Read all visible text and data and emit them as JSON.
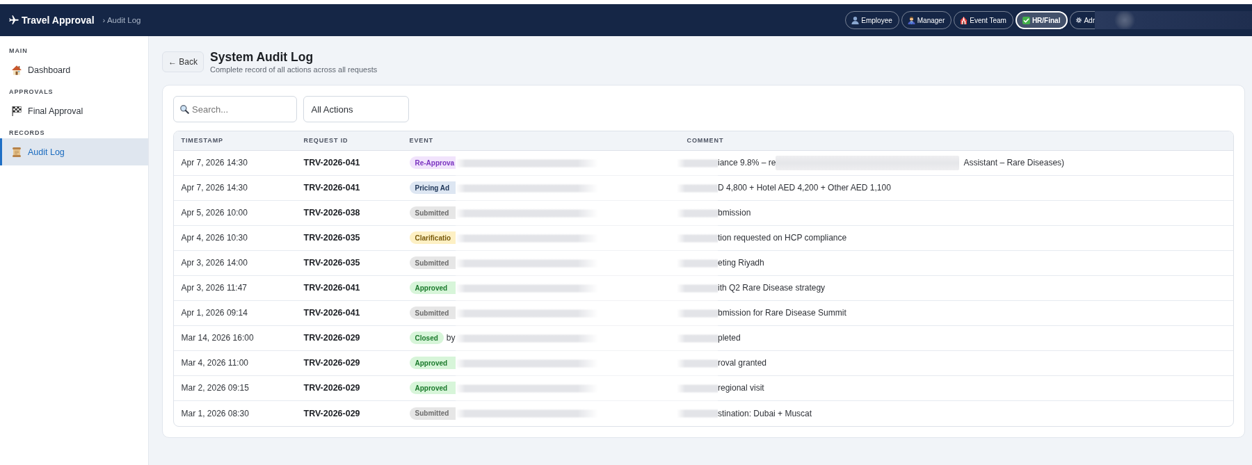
{
  "app": {
    "title": "Travel Approval",
    "breadcrumb": "› Audit Log"
  },
  "roles": [
    {
      "label": "Employee",
      "selected": false
    },
    {
      "label": "Manager",
      "selected": false
    },
    {
      "label": "Event Team",
      "selected": false
    },
    {
      "label": "HR/Final",
      "selected": true
    },
    {
      "label": "Adr",
      "selected": false
    }
  ],
  "sidebar": {
    "sections": [
      {
        "label": "MAIN",
        "items": [
          {
            "label": "Dashboard",
            "selected": false
          }
        ]
      },
      {
        "label": "APPROVALS",
        "items": [
          {
            "label": "Final Approval",
            "selected": false
          }
        ]
      },
      {
        "label": "RECORDS",
        "items": [
          {
            "label": "Audit Log",
            "selected": true
          }
        ]
      }
    ]
  },
  "page": {
    "back_button": "← Back",
    "title": "System Audit Log",
    "subtitle": "Complete record of all actions across all requests"
  },
  "filters": {
    "search": {
      "placeholder": "Search..."
    },
    "action_filter": {
      "value": "All Actions"
    }
  },
  "table": {
    "columns": [
      "TIMESTAMP",
      "REQUEST ID",
      "EVENT",
      "COMMENT"
    ],
    "rows": [
      {
        "timestamp": "Apr 7, 2026 14:30",
        "request_id": "TRV-2026-041",
        "event": {
          "kind": "reapproval",
          "badge": "Re-Approva"
        },
        "comment_fragments": [
          "iance 9.8% – re",
          "Assistant – Rare Diseases)"
        ]
      },
      {
        "timestamp": "Apr 7, 2026 14:30",
        "request_id": "TRV-2026-041",
        "event": {
          "kind": "pricing",
          "badge": "Pricing Ad"
        },
        "comment_fragments": [
          "D 4,800 + Hotel AED 4,200 + Other AED 1,100"
        ]
      },
      {
        "timestamp": "Apr 5, 2026 10:00",
        "request_id": "TRV-2026-038",
        "event": {
          "kind": "submitted",
          "badge": "Submitted"
        },
        "comment_fragments": [
          "bmission"
        ]
      },
      {
        "timestamp": "Apr 4, 2026 10:30",
        "request_id": "TRV-2026-035",
        "event": {
          "kind": "clarification",
          "badge": "Clarificatio"
        },
        "comment_fragments": [
          "tion requested on HCP compliance"
        ]
      },
      {
        "timestamp": "Apr 3, 2026 14:00",
        "request_id": "TRV-2026-035",
        "event": {
          "kind": "submitted",
          "badge": "Submitted"
        },
        "comment_fragments": [
          "eting Riyadh"
        ]
      },
      {
        "timestamp": "Apr 3, 2026 11:47",
        "request_id": "TRV-2026-041",
        "event": {
          "kind": "approved",
          "badge": "Approved"
        },
        "comment_fragments": [
          "ith Q2 Rare Disease strategy"
        ]
      },
      {
        "timestamp": "Apr 1, 2026 09:14",
        "request_id": "TRV-2026-041",
        "event": {
          "kind": "submitted",
          "badge": "Submitted"
        },
        "comment_fragments": [
          "bmission for Rare Disease Summit"
        ]
      },
      {
        "timestamp": "Mar 14, 2026 16:00",
        "request_id": "TRV-2026-029",
        "event": {
          "kind": "closed",
          "badge": "Closed",
          "note": "by"
        },
        "comment_fragments": [
          "pleted"
        ]
      },
      {
        "timestamp": "Mar 4, 2026 11:00",
        "request_id": "TRV-2026-029",
        "event": {
          "kind": "approved",
          "badge": "Approved"
        },
        "comment_fragments": [
          "roval granted"
        ]
      },
      {
        "timestamp": "Mar 2, 2026 09:15",
        "request_id": "TRV-2026-029",
        "event": {
          "kind": "approved",
          "badge": "Approved"
        },
        "comment_fragments": [
          "regional visit"
        ]
      },
      {
        "timestamp": "Mar 1, 2026 08:30",
        "request_id": "TRV-2026-029",
        "event": {
          "kind": "submitted",
          "badge": "Submitted"
        },
        "comment_fragments": [
          "stination: Dubai + Muscat"
        ]
      }
    ]
  }
}
